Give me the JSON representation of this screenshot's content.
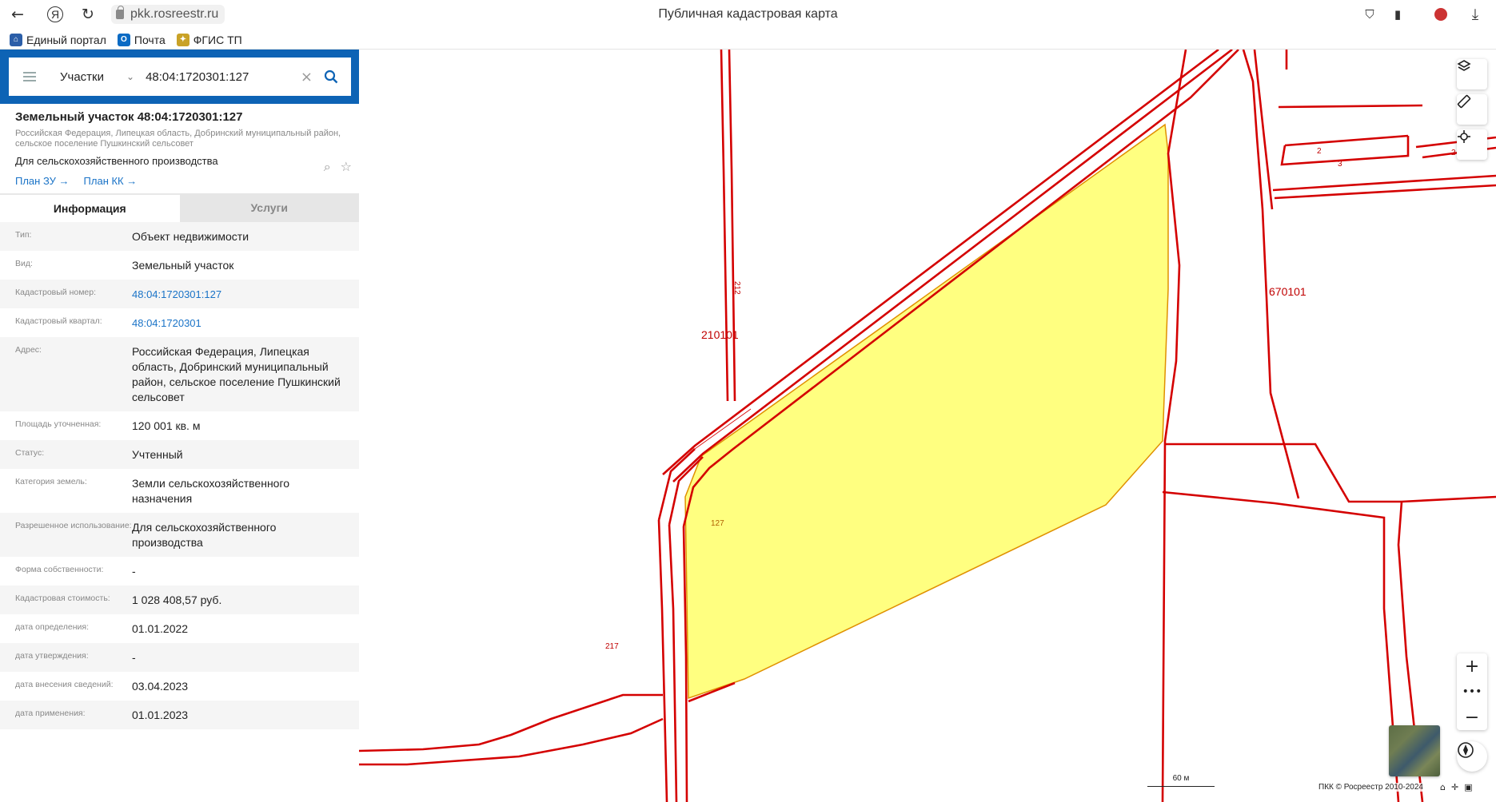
{
  "browser": {
    "url": "pkk.rosreestr.ru",
    "page_title": "Публичная кадастровая карта",
    "bookmarks": [
      "Единый портал",
      "Почта",
      "ФГИС ТП"
    ]
  },
  "search": {
    "category": "Участки",
    "query": "48:04:1720301:127"
  },
  "card": {
    "title": "Земельный участок 48:04:1720301:127",
    "address_short": "Российская Федерация, Липецкая область, Добринский муниципальный район, сельское поселение Пушкинский сельсовет",
    "purpose": "Для сельскохозяйственного производства",
    "links": [
      "План ЗУ →",
      "План КК →"
    ]
  },
  "tabs": [
    "Информация",
    "Услуги"
  ],
  "info": [
    {
      "key": "Тип:",
      "value": "Объект недвижимости"
    },
    {
      "key": "Вид:",
      "value": "Земельный участок"
    },
    {
      "key": "Кадастровый номер:",
      "value": "48:04:1720301:127"
    },
    {
      "key": "Кадастровый квартал:",
      "value": "48:04:1720301"
    },
    {
      "key": "Адрес:",
      "value": "Российская Федерация, Липецкая область, Добринский муниципальный район, сельское поселение Пушкинский сельсовет"
    },
    {
      "key": "Площадь уточненная:",
      "value": "120 001 кв. м"
    },
    {
      "key": "Статус:",
      "value": "Учтенный"
    },
    {
      "key": "Категория земель:",
      "value": "Земли сельскохозяйственного назначения"
    },
    {
      "key": "Разрешенное использование:",
      "value": "Для сельскохозяйственного производства"
    },
    {
      "key": "Форма собственности:",
      "value": "-"
    },
    {
      "key": "Кадастровая стоимость:",
      "value": "1 028 408,57 руб."
    },
    {
      "key": "дата определения:",
      "value": "01.01.2022"
    },
    {
      "key": "дата утверждения:",
      "value": "-"
    },
    {
      "key": "дата внесения сведений:",
      "value": "03.04.2023"
    },
    {
      "key": "дата применения:",
      "value": "01.01.2023"
    }
  ],
  "map": {
    "labels": [
      "210101",
      "670101",
      "127",
      "212",
      "217",
      "2",
      "3",
      "2"
    ],
    "scale": "60 м",
    "copyright": "ПКК © Росреестр 2010-2024",
    "parcel_fill": "#ffff80",
    "boundary_color": "#d40000"
  }
}
